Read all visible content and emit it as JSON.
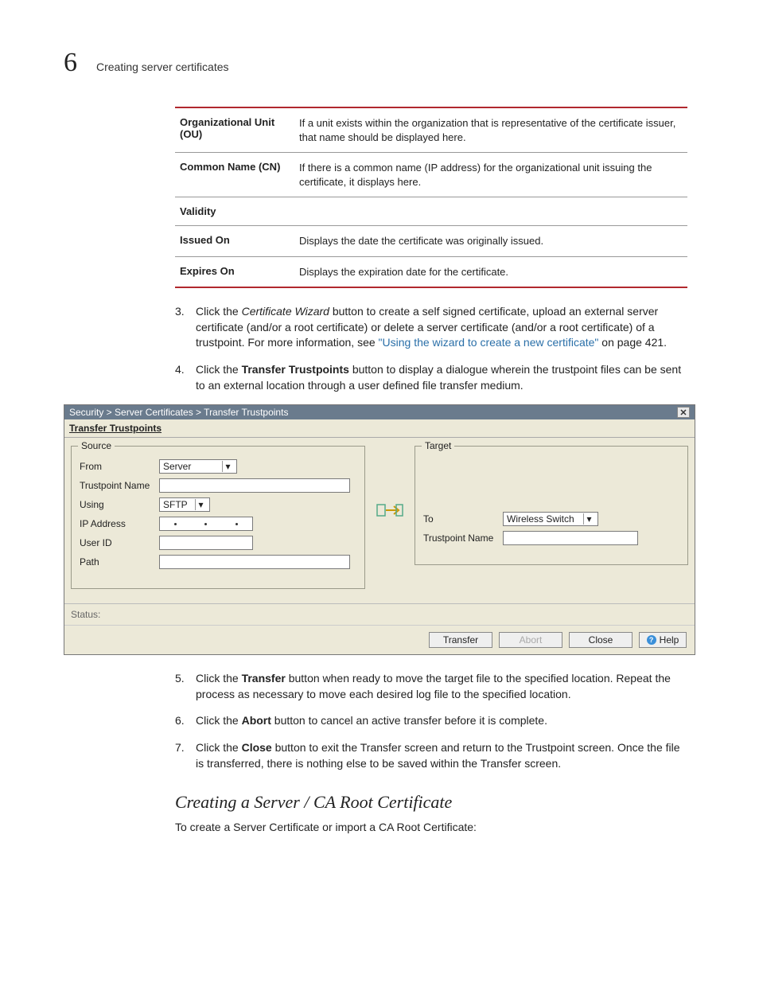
{
  "header": {
    "chapter_number": "6",
    "title": "Creating server certificates"
  },
  "definitions": [
    {
      "term": "Organizational Unit (OU)",
      "desc": "If a unit exists within the organization that is representative of the certificate issuer, that name should be displayed here."
    },
    {
      "term": "Common Name (CN)",
      "desc": "If there is a common name (IP address) for the organizational unit issuing the certificate, it displays here."
    },
    {
      "term": "Validity",
      "desc": ""
    },
    {
      "term": "Issued On",
      "desc": "Displays the date the certificate was originally issued."
    },
    {
      "term": "Expires On",
      "desc": "Displays the expiration date for the certificate."
    }
  ],
  "step3": {
    "num": "3.",
    "pre": "Click the ",
    "wizard": "Certificate Wizard",
    "mid": " button to create a self signed certificate, upload an external server certificate (and/or a root certificate) or delete a server certificate (and/or a root certificate) of a trustpoint. For more information, see ",
    "link": "\"Using the wizard to create a new certificate\"",
    "post": " on page 421."
  },
  "step4": {
    "num": "4.",
    "pre": "Click the ",
    "b": "Transfer Trustpoints",
    "post": " button to display a dialogue wherein the trustpoint files can be sent to an external location through a user defined file transfer medium."
  },
  "dialog": {
    "breadcrumb": "Security > Server Certificates > Transfer Trustpoints",
    "subtitle": "Transfer Trustpoints",
    "source": {
      "legend": "Source",
      "from_label": "From",
      "from_value": "Server",
      "tp_label": "Trustpoint Name",
      "using_label": "Using",
      "using_value": "SFTP",
      "ip_label": "IP Address",
      "user_label": "User ID",
      "path_label": "Path"
    },
    "target": {
      "legend": "Target",
      "to_label": "To",
      "to_value": "Wireless Switch",
      "tp_label": "Trustpoint Name"
    },
    "status_label": "Status:",
    "buttons": {
      "transfer": "Transfer",
      "abort": "Abort",
      "close": "Close",
      "help": "Help"
    }
  },
  "step5": {
    "num": "5.",
    "pre": "Click the ",
    "b": "Transfer",
    "post": " button when ready to move the target file to the specified location. Repeat the process as necessary to move each desired log file to the specified location."
  },
  "step6": {
    "num": "6.",
    "pre": "Click the ",
    "b": "Abort",
    "post": " button to cancel an active transfer before it is complete."
  },
  "step7": {
    "num": "7.",
    "pre": "Click the ",
    "b": "Close",
    "post": " button to exit the Transfer screen and return to the Trustpoint screen. Once the file is transferred, there is nothing else to be saved within the Transfer screen."
  },
  "subheading": "Creating a Server / CA Root Certificate",
  "subtext": "To create a Server Certificate or import a CA Root Certificate:"
}
